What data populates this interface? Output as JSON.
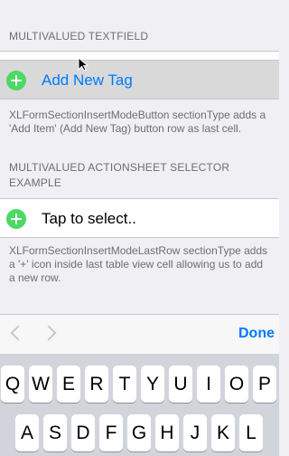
{
  "section1": {
    "header": "MULTIVALUED TEXTFIELD",
    "add_label": "Add New Tag",
    "footer": "XLFormSectionInsertModeButton sectionType adds a 'Add Item' (Add New Tag) button row as last cell."
  },
  "section2": {
    "header": "MULTIVALUED ACTIONSHEET SELECTOR EXAMPLE",
    "row_label": "Tap to select..",
    "footer": "XLFormSectionInsertModeLastRow sectionType adds a '+' icon inside last table view cell allowing us to add a new row."
  },
  "toolbar": {
    "prev_icon": "chevron-left-icon",
    "next_icon": "chevron-right-icon",
    "done_label": "Done"
  },
  "keyboard": {
    "row1": [
      "Q",
      "W",
      "E",
      "R",
      "T",
      "Y",
      "U",
      "I",
      "O",
      "P"
    ],
    "row2": [
      "A",
      "S",
      "D",
      "F",
      "G",
      "H",
      "J",
      "K",
      "L"
    ]
  },
  "colors": {
    "accent": "#007aff",
    "add_green": "#4cd964",
    "background": "#efeff4",
    "keyboard": "#d1d5db"
  }
}
